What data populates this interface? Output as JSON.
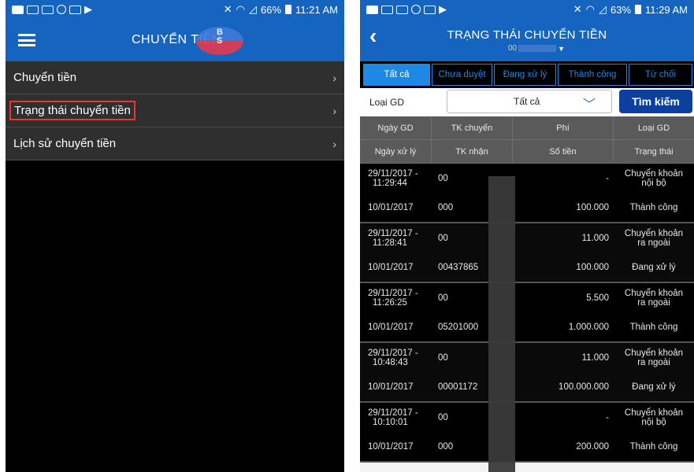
{
  "left": {
    "status": {
      "battery": "66%",
      "time": "11:21 AM"
    },
    "title": "CHUYỂN TIỀN",
    "logo_letters": [
      "B",
      "S"
    ],
    "menu": [
      {
        "label": "Chuyển tiền"
      },
      {
        "label": "Trạng thái chuyển tiền"
      },
      {
        "label": "Lịch sử chuyển tiền"
      }
    ]
  },
  "right": {
    "status": {
      "battery": "63%",
      "time": "11:29 AM"
    },
    "title": "TRẠNG THÁI CHUYỂN TIỀN",
    "account_prefix": "00",
    "tabs": [
      "Tất cả",
      "Chưa duyệt",
      "Đang xử lý",
      "Thành công",
      "Từ chối"
    ],
    "active_tab": "Tất cả",
    "filter": {
      "label": "Loại GD",
      "value": "Tất cả",
      "search_label": "Tìm kiếm"
    },
    "headers_top": [
      "Ngày GD",
      "TK chuyển",
      "Phí",
      "Loại GD"
    ],
    "headers_bottom": [
      "Ngày xử lý",
      "TK nhận",
      "Số tiền",
      "Trạng thái"
    ],
    "records": [
      {
        "date": "29/11/2017 -",
        "time": "11:29:44",
        "tk_chuyen": "00",
        "fee": "-",
        "type1": "Chuyển khoản",
        "type2": "nội bộ",
        "process_date": "10/01/2017",
        "tk_nhan": "000",
        "amount": "100.000",
        "status": "Thành công"
      },
      {
        "date": "29/11/2017 -",
        "time": "11:28:41",
        "tk_chuyen": "00",
        "fee": "11.000",
        "type1": "Chuyển khoản",
        "type2": "ra ngoài",
        "process_date": "10/01/2017",
        "tk_nhan": "00437865",
        "amount": "100.000",
        "status": "Đang xử lý"
      },
      {
        "date": "29/11/2017 -",
        "time": "11:26:25",
        "tk_chuyen": "00",
        "fee": "5.500",
        "type1": "Chuyển khoản",
        "type2": "ra ngoài",
        "process_date": "10/01/2017",
        "tk_nhan": "05201000",
        "amount": "1.000.000",
        "status": "Thành công"
      },
      {
        "date": "29/11/2017 -",
        "time": "10:48:43",
        "tk_chuyen": "00",
        "fee": "11.000",
        "type1": "Chuyển khoản",
        "type2": "ra ngoài",
        "process_date": "10/01/2017",
        "tk_nhan": "00001172",
        "amount": "100.000.000",
        "status": "Đang xử lý"
      },
      {
        "date": "29/11/2017 -",
        "time": "10:10:01",
        "tk_chuyen": "00",
        "fee": "-",
        "type1": "Chuyển khoản",
        "type2": "nội bộ",
        "process_date": "10/01/2017",
        "tk_nhan": "000",
        "amount": "200.000",
        "status": "Thành công"
      }
    ]
  }
}
